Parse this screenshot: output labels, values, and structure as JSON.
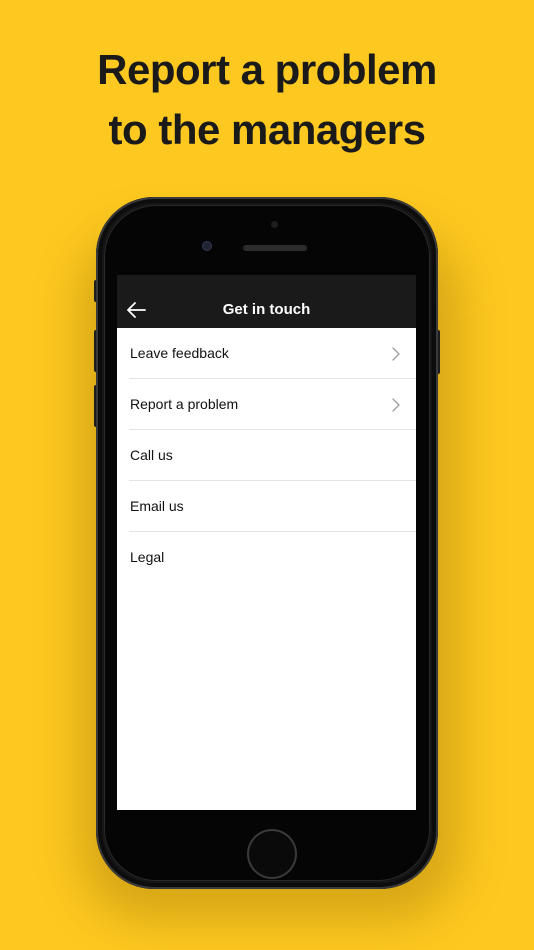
{
  "headline": {
    "line1": "Report a problem",
    "line2": "to the managers"
  },
  "colors": {
    "background": "#FDC81F",
    "navbar": "#1A1A1A",
    "list_background": "#FFFFFF",
    "text_dark": "#111111",
    "chevron": "#A0A0A0"
  },
  "navbar": {
    "back_icon": "arrow-left-icon",
    "title": "Get in touch"
  },
  "menu": {
    "items": [
      {
        "label": "Leave feedback",
        "has_chevron": true
      },
      {
        "label": "Report a problem",
        "has_chevron": true
      },
      {
        "label": "Call us",
        "has_chevron": false
      },
      {
        "label": "Email us",
        "has_chevron": false
      },
      {
        "label": "Legal",
        "has_chevron": false
      }
    ]
  }
}
